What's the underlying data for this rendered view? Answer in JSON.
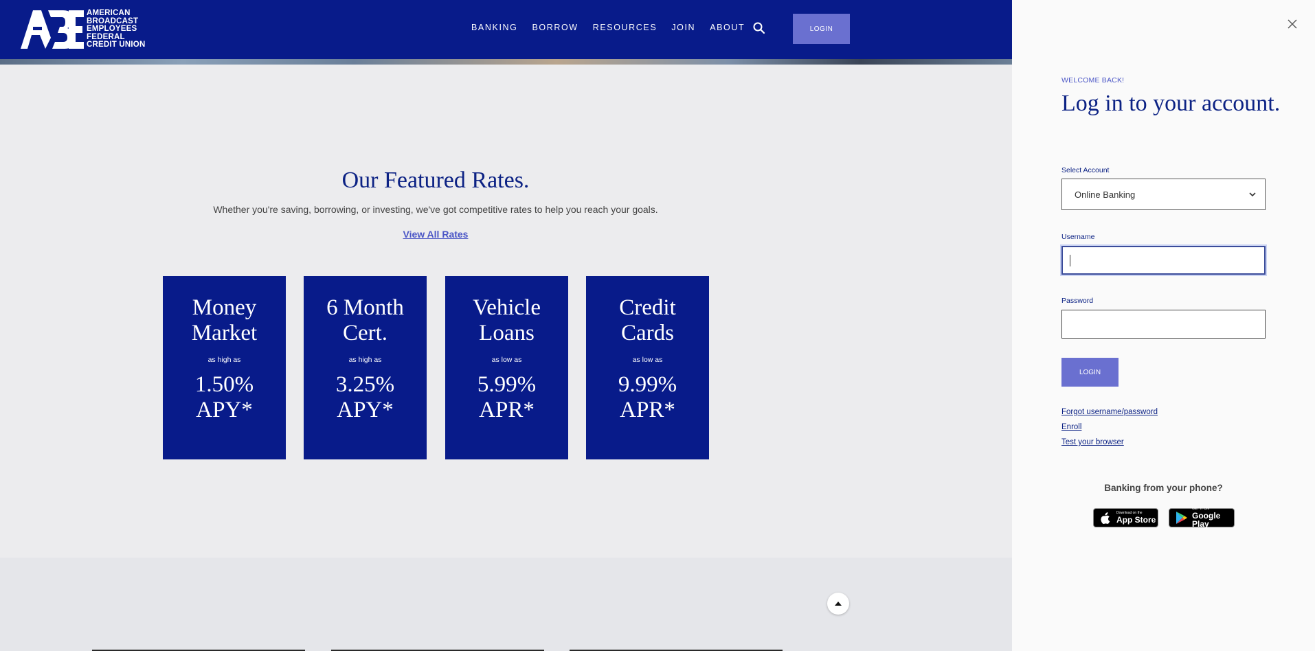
{
  "header": {
    "logo_mark": "ABE",
    "logo_lines": [
      "AMERICAN",
      "BROADCAST",
      "EMPLOYEES",
      "FEDERAL",
      "CREDIT UNION"
    ],
    "nav": [
      "BANKING",
      "BORROW",
      "RESOURCES",
      "JOIN",
      "ABOUT"
    ],
    "login_label": "LOGIN",
    "brand_color": "#081b8a",
    "accent_color": "#6a70d0"
  },
  "rates": {
    "title": "Our Featured Rates.",
    "subtitle": "Whether you're saving, borrowing, or investing, we've got competitive rates to help you reach your goals.",
    "view_all": "View All Rates",
    "cards": [
      {
        "name": "Money Market",
        "qualifier": "as high as",
        "rate": "1.50%",
        "unit": "APY*"
      },
      {
        "name": "6 Month Cert.",
        "qualifier": "as high as",
        "rate": "3.25%",
        "unit": "APY*"
      },
      {
        "name": "Vehicle Loans",
        "qualifier": "as low as",
        "rate": "5.99%",
        "unit": "APR*"
      },
      {
        "name": "Credit Cards",
        "qualifier": "as low as",
        "rate": "9.99%",
        "unit": "APR*"
      }
    ]
  },
  "login_panel": {
    "welcome": "WELCOME BACK!",
    "title": "Log in to your account.",
    "select_label": "Select Account",
    "select_value": "Online Banking",
    "username_label": "Username",
    "username_value": "",
    "password_label": "Password",
    "password_value": "",
    "login_label": "LOGIN",
    "links": [
      "Forgot username/password",
      "Enroll",
      "Test your browser"
    ],
    "phone_text": "Banking from your phone?",
    "app_store": {
      "small": "Download on the",
      "big": "App Store",
      "icon": "apple-icon"
    },
    "google_play": {
      "small": "GET IT ON",
      "big": "Google Play",
      "icon": "google-play-icon"
    }
  }
}
